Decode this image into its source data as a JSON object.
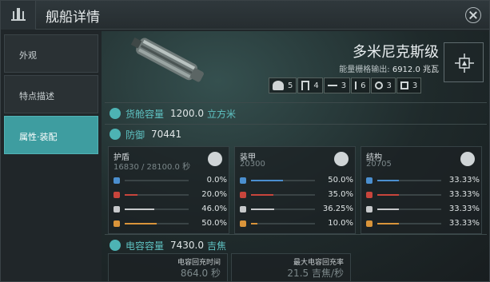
{
  "window": {
    "title": "舰船详情",
    "header_icon": "station-icon",
    "close_icon": "close-icon"
  },
  "sidebar": {
    "items": [
      {
        "label": "外观",
        "active": false
      },
      {
        "label": "特点描述",
        "active": false
      },
      {
        "label": "属性·装配",
        "active": true
      }
    ]
  },
  "ship": {
    "name": "多米尼克斯级",
    "power_output_label": "能量栅格输出:",
    "power_output_value": "6912.0 兆瓦"
  },
  "slots": [
    {
      "icon": "turret-hardpoint-icon",
      "value": "5"
    },
    {
      "icon": "launcher-hardpoint-icon",
      "value": "4"
    },
    {
      "icon": "high-slot-icon",
      "value": "3"
    },
    {
      "icon": "med-slot-icon",
      "value": "6"
    },
    {
      "icon": "low-slot-icon",
      "value": "3"
    },
    {
      "icon": "rig-slot-icon",
      "value": "3"
    }
  ],
  "cargo": {
    "label": "货舱容量",
    "value": "1200.0",
    "unit": "立方米"
  },
  "defense": {
    "label": "防御",
    "value": "70441"
  },
  "resist_colors": {
    "em": "#4b8fcf",
    "thermal": "#c8453c",
    "kinetic": "#c7c9cb",
    "explosive": "#d9943a"
  },
  "resists": [
    {
      "title": "护盾",
      "hp": "16830 / 28100.0 秒",
      "icon": "shield-icon",
      "values": [
        0.0,
        20.0,
        46.0,
        50.0
      ],
      "labels": [
        "0.0%",
        "20.0%",
        "46.0%",
        "50.0%"
      ]
    },
    {
      "title": "装甲",
      "hp": "20300",
      "icon": "armor-icon",
      "values": [
        50.0,
        35.0,
        36.25,
        10.0
      ],
      "labels": [
        "50.0%",
        "35.0%",
        "36.25%",
        "10.0%"
      ]
    },
    {
      "title": "结构",
      "hp": "20705",
      "icon": "structure-icon",
      "values": [
        33.33,
        33.33,
        33.33,
        33.33
      ],
      "labels": [
        "33.33%",
        "33.33%",
        "33.33%",
        "33.33%"
      ]
    }
  ],
  "capacitor": {
    "label": "电容容量",
    "value": "7430.0",
    "unit": "吉焦",
    "recharge_time_label": "电容回充时间",
    "recharge_time_value": "864.0 秒",
    "max_rate_label": "最大电容回充率",
    "max_rate_value": "21.5 吉焦/秒"
  }
}
